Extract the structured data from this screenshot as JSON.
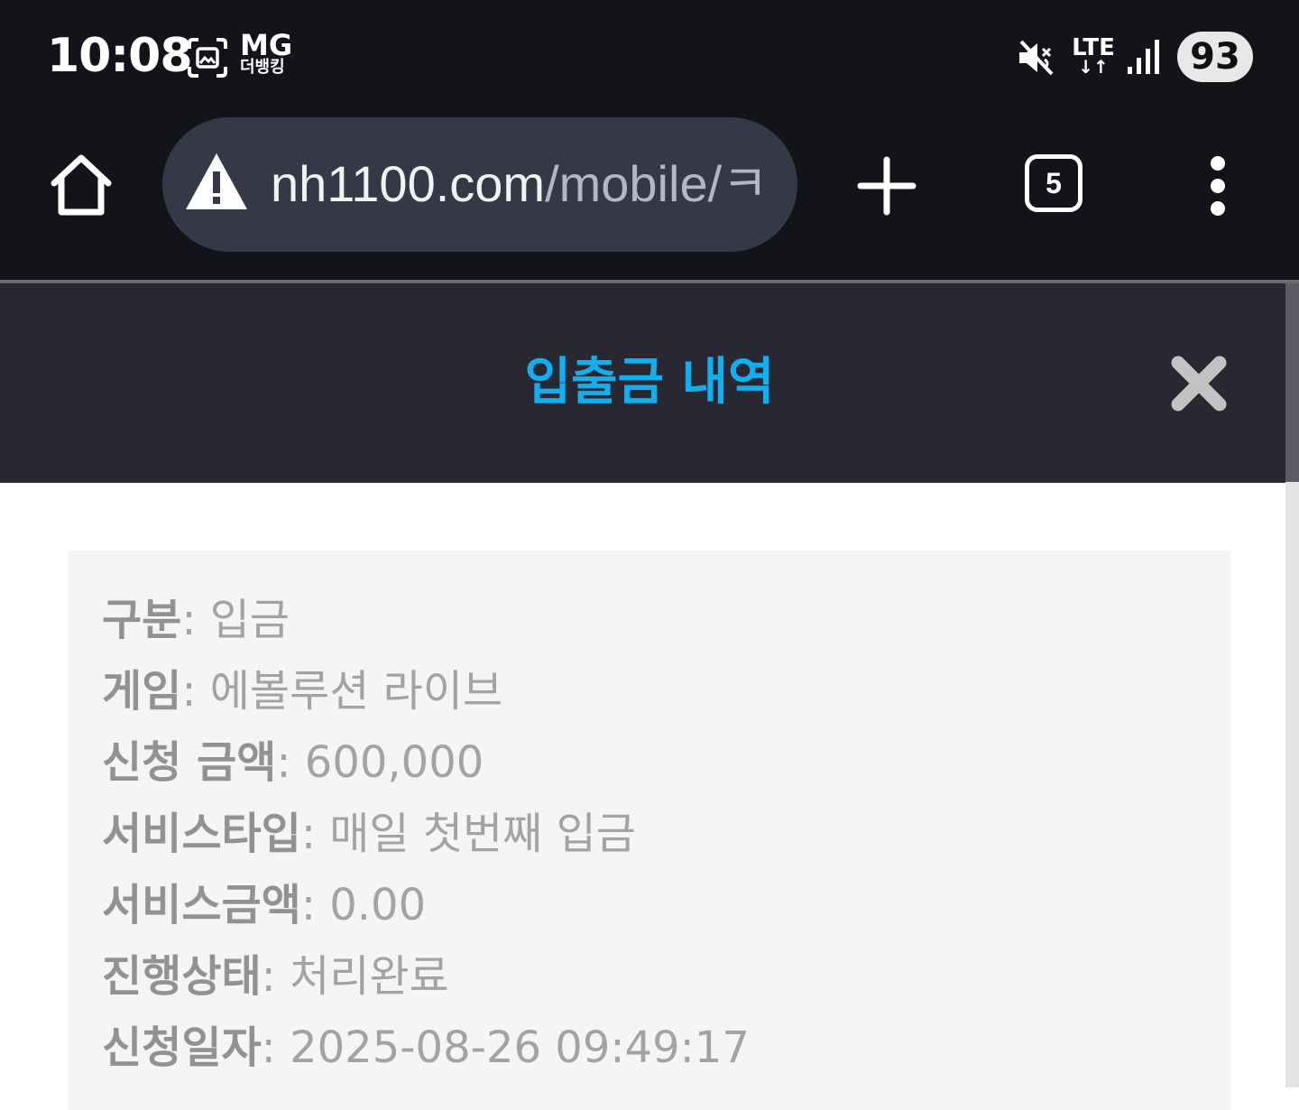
{
  "status_bar": {
    "time": "10:08",
    "carrier_name": "MG",
    "carrier_sub": "더뱅킹",
    "network": "LTE",
    "network_arrows": "↓↑",
    "battery": "93",
    "icons": [
      "screenshot-icon",
      "mute-icon",
      "signal-icon"
    ]
  },
  "browser": {
    "url_host": "nh1100.com",
    "url_path": "/mobile/",
    "url_cut": "ㅋ",
    "tab_count": "5",
    "icons": [
      "home-icon",
      "warning-icon",
      "plus-icon",
      "menu-icon"
    ]
  },
  "modal": {
    "title": "입출금 내역",
    "close_icon": "close-icon",
    "title_color": "#12aef0"
  },
  "details": [
    {
      "label": "구분",
      "value": "입금"
    },
    {
      "label": "게임",
      "value": "에볼루션 라이브"
    },
    {
      "label": "신청 금액",
      "value": "600,000"
    },
    {
      "label": "서비스타입",
      "value": "매일 첫번째 입금"
    },
    {
      "label": "서비스금액",
      "value": "0.00"
    },
    {
      "label": "진행상태",
      "value": "처리완료"
    },
    {
      "label": "신청일자",
      "value": "2025-08-26 09:49:17"
    }
  ]
}
